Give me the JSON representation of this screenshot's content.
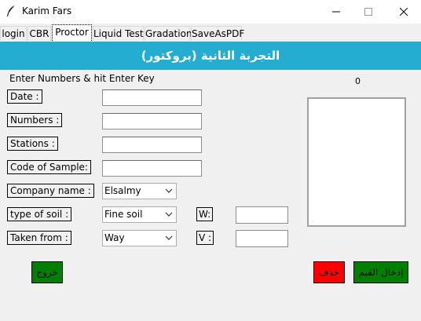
{
  "window": {
    "title": "Karim Fars",
    "icon": "feather-icon"
  },
  "tabs": [
    {
      "label": "login",
      "active": false
    },
    {
      "label": "CBR",
      "active": false
    },
    {
      "label": "Proctor",
      "active": true
    },
    {
      "label": "Liquid Test",
      "active": false
    },
    {
      "label": "Gradation",
      "active": false
    },
    {
      "label": "SaveAsPDF",
      "active": false
    }
  ],
  "header": {
    "title": "التجربة الثانية (بروكتور)",
    "color": "#25acd1"
  },
  "form": {
    "hint": "Enter Numbers & hit Enter Key",
    "counter": "0",
    "fields": [
      {
        "label": "Date :",
        "value": ""
      },
      {
        "label": "Numbers :",
        "value": ""
      },
      {
        "label": "Stations :",
        "value": ""
      },
      {
        "label": "Code of Sample:",
        "value": ""
      }
    ],
    "company": {
      "label": "Company name :",
      "value": "Elsalmy"
    },
    "soil": {
      "label": "type of soil :",
      "value": "Fine soil"
    },
    "taken": {
      "label": "Taken from :",
      "value": "Way"
    },
    "w": {
      "label": "W:",
      "value": ""
    },
    "v": {
      "label": "V :",
      "value": ""
    }
  },
  "buttons": {
    "exit": "خروج",
    "delete": "حذف",
    "enter": "إدخال القيم"
  },
  "colors": {
    "green": "#008000",
    "red": "#ff0000"
  }
}
